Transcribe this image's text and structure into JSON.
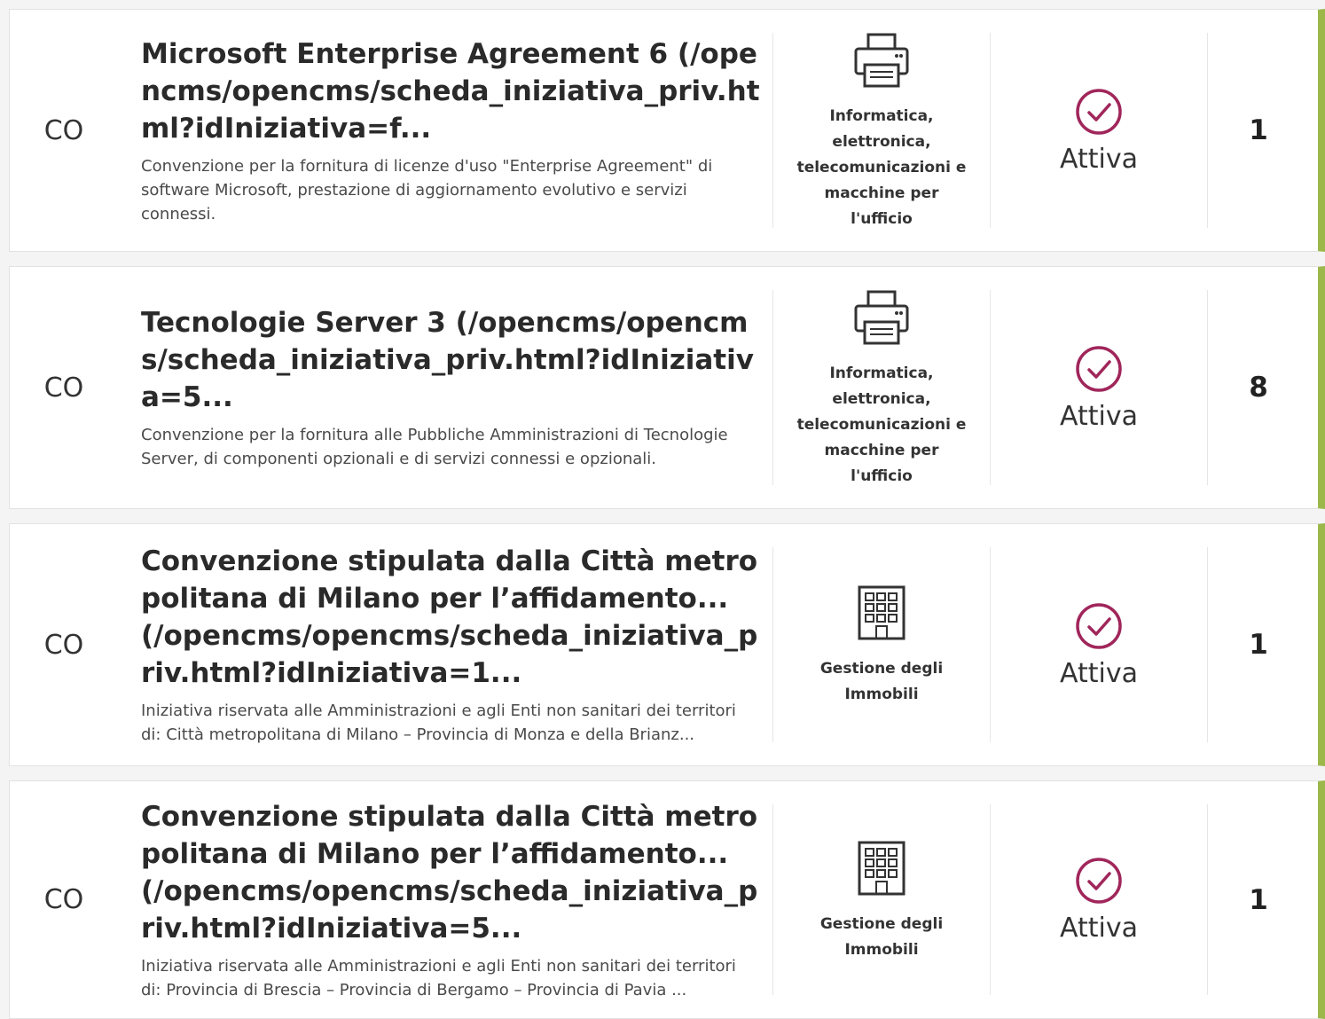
{
  "rows": [
    {
      "type": "CO",
      "title": "Microsoft Enterprise Agreement 6 (/opencms/opencms/scheda_iniziativa_priv.html?idIniziativa=f...",
      "description": "Convenzione per la fornitura di licenze d'uso \"Enterprise Agreement\" di software Microsoft, prestazione di aggiornamento evolutivo e servizi connessi.",
      "category": "Informatica, elettronica, telecomunicazioni e macchine per l'ufficio",
      "category_icon": "printer-icon",
      "status": "Attiva",
      "count": "1"
    },
    {
      "type": "CO",
      "title": "Tecnologie Server 3 (/opencms/opencms/scheda_iniziativa_priv.html?idIniziativa=5...",
      "description": "Convenzione per la fornitura alle Pubbliche Amministrazioni di Tecnologie Server, di componenti opzionali e di servizi connessi e opzionali.",
      "category": "Informatica, elettronica, telecomunicazioni e macchine per l'ufficio",
      "category_icon": "printer-icon",
      "status": "Attiva",
      "count": "8"
    },
    {
      "type": "CO",
      "title": "Convenzione stipulata dalla Città metropolitana di Milano per l’affidamento... (/opencms/opencms/scheda_iniziativa_priv.html?idIniziativa=1...",
      "description": "Iniziativa riservata alle Amministrazioni e agli Enti non sanitari dei territori di: Città metropolitana di Milano – Provincia di Monza e della Brianz...",
      "category": "Gestione degli Immobili",
      "category_icon": "building-icon",
      "status": "Attiva",
      "count": "1"
    },
    {
      "type": "CO",
      "title": "Convenzione stipulata dalla Città metropolitana di Milano per l’affidamento... (/opencms/opencms/scheda_iniziativa_priv.html?idIniziativa=5...",
      "description": "Iniziativa riservata alle Amministrazioni e agli Enti non sanitari dei territori di: Provincia di Brescia – Provincia di Bergamo – Provincia di Pavia ...",
      "category": "Gestione degli Immobili",
      "category_icon": "building-icon",
      "status": "Attiva",
      "count": "1"
    }
  ],
  "colors": {
    "accent_bar": "#9cb84a",
    "status_icon": "#a0265b"
  }
}
